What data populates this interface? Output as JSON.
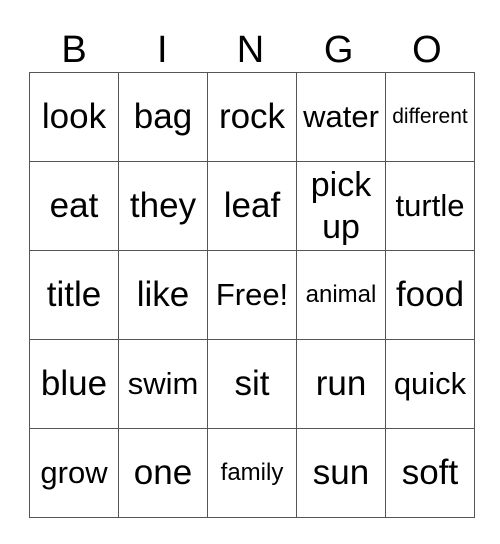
{
  "header": [
    "B",
    "I",
    "N",
    "G",
    "O"
  ],
  "rows": [
    [
      "look",
      "bag",
      "rock",
      "water",
      "different"
    ],
    [
      "eat",
      "they",
      "leaf",
      "pick up",
      "turtle"
    ],
    [
      "title",
      "like",
      "Free!",
      "animal",
      "food"
    ],
    [
      "blue",
      "swim",
      "sit",
      "run",
      "quick"
    ],
    [
      "grow",
      "one",
      "family",
      "sun",
      "soft"
    ]
  ]
}
